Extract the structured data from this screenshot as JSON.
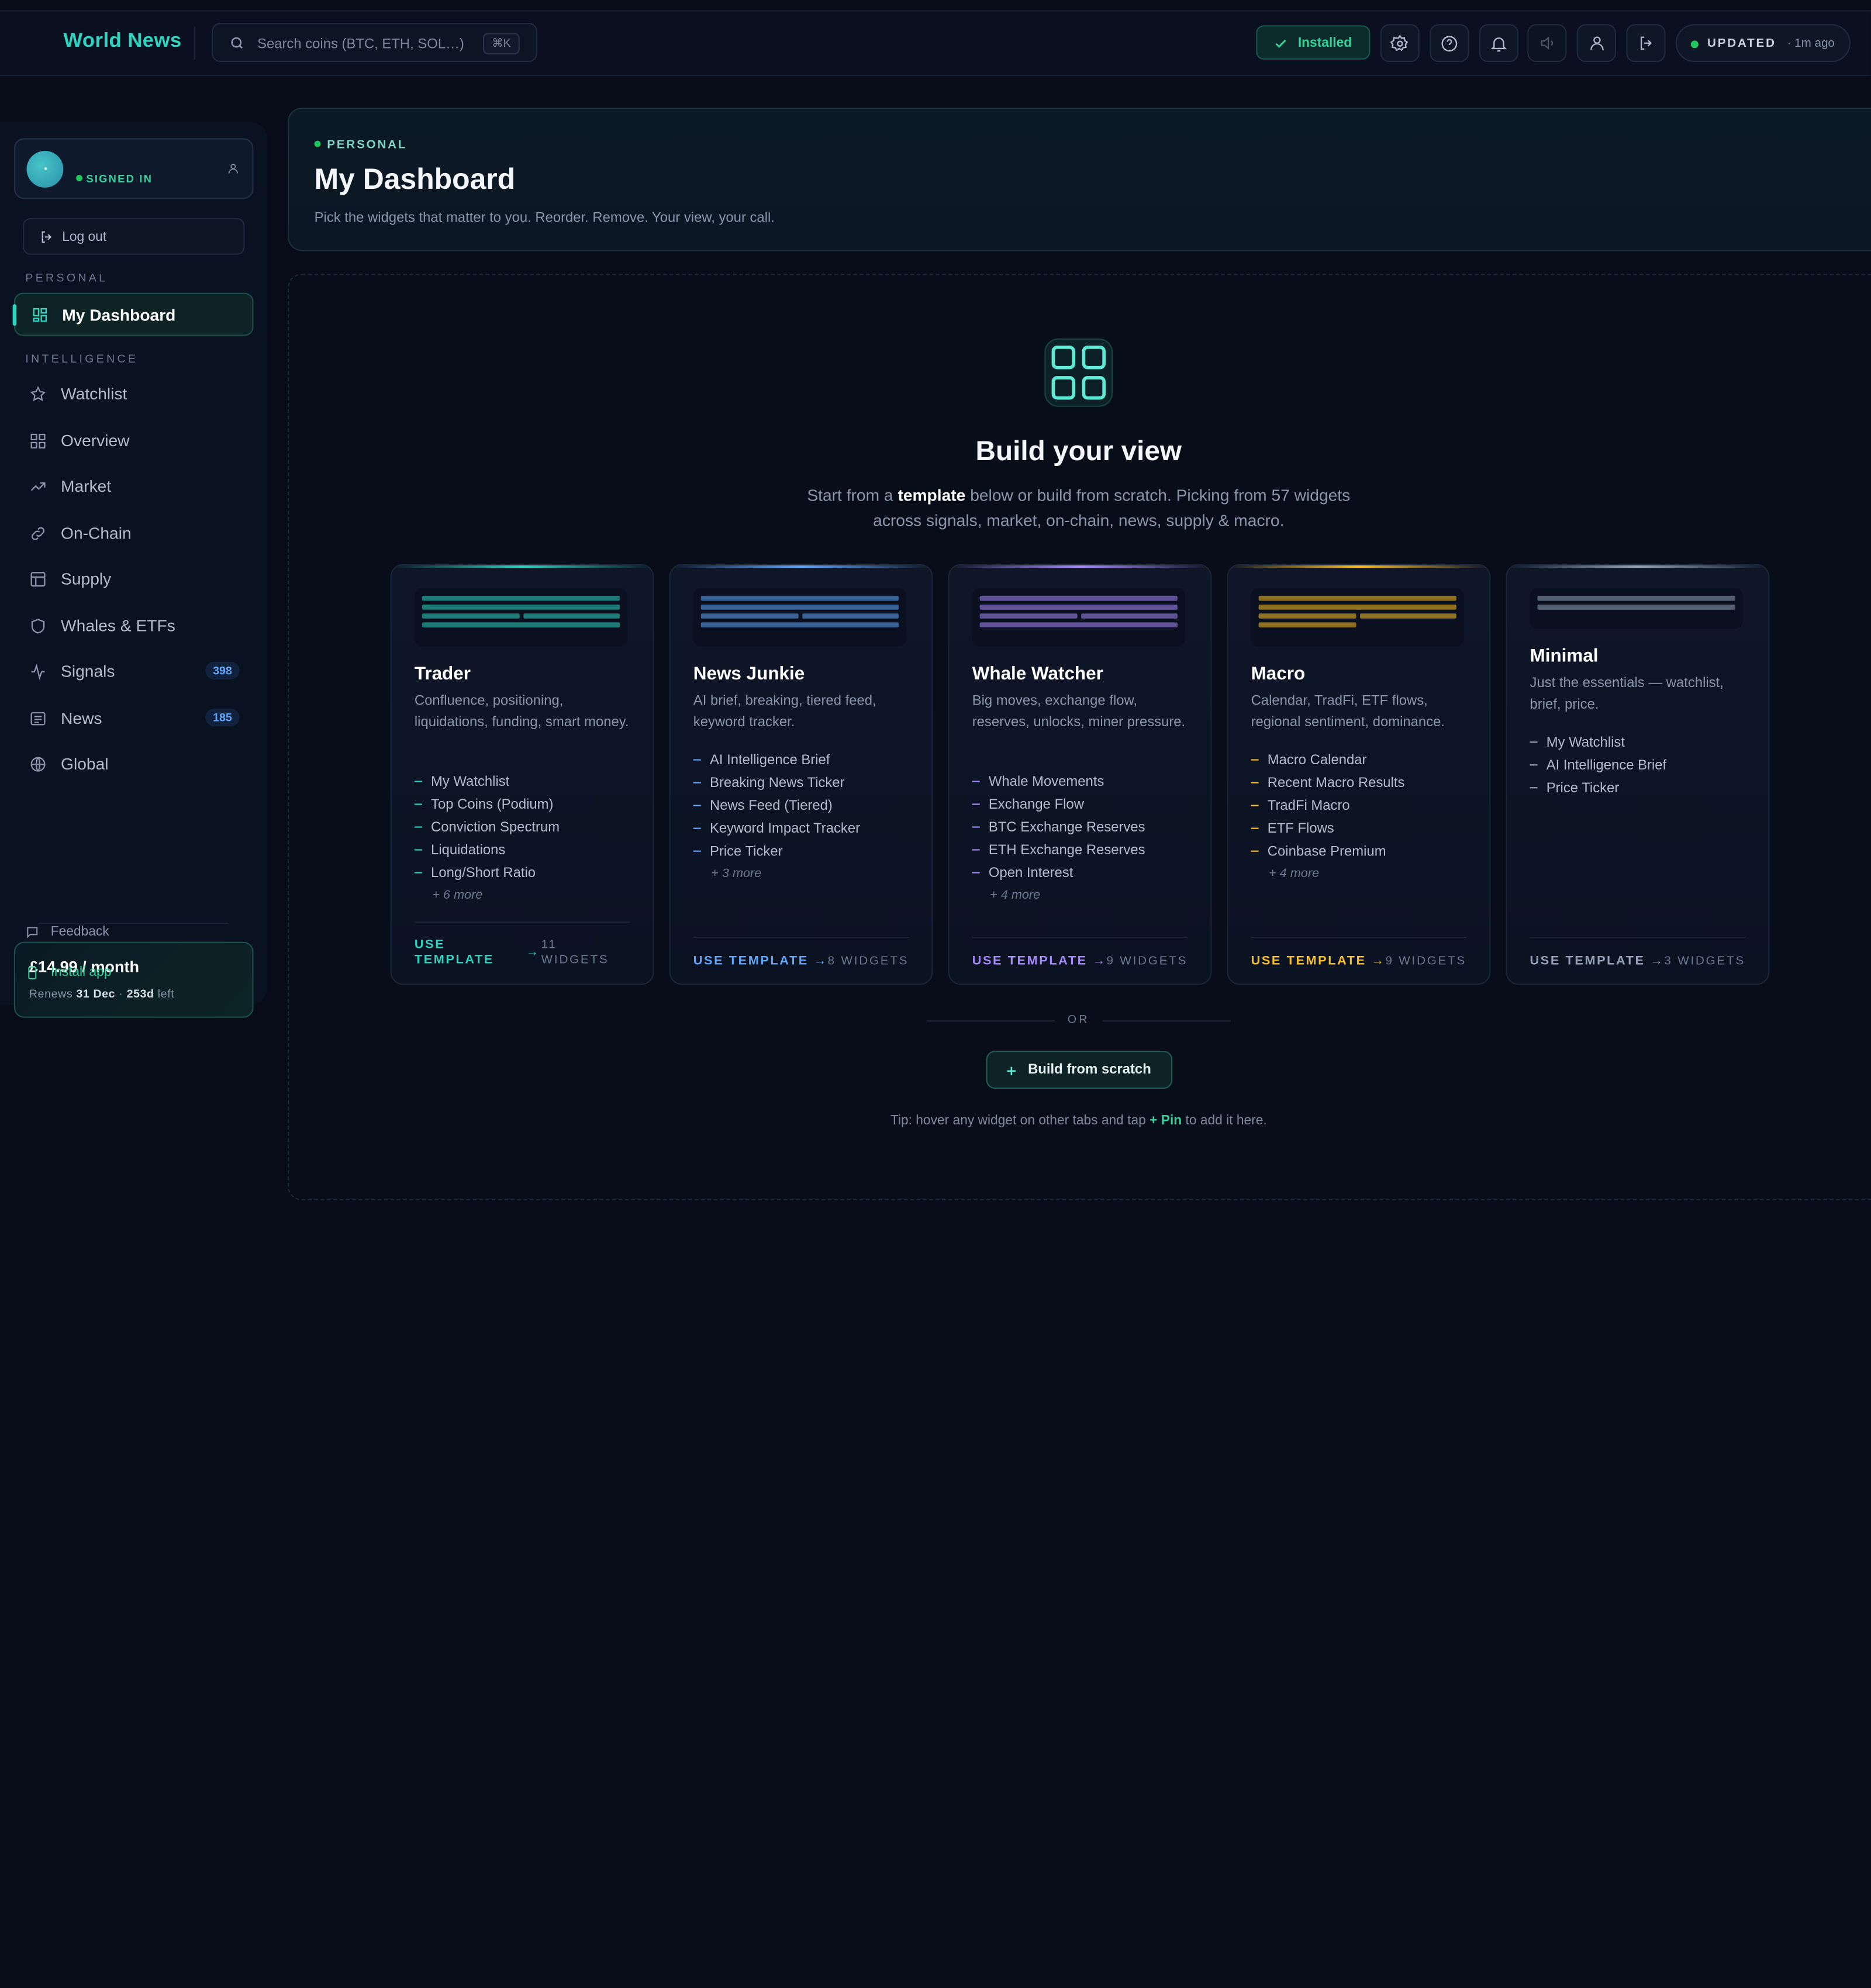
{
  "app": {
    "brand": "World News"
  },
  "search": {
    "placeholder": "Search coins (BTC, ETH, SOL…)",
    "shortcut": "⌘K"
  },
  "topbar": {
    "installed_label": "Installed",
    "icons": [
      "settings-icon",
      "help-icon",
      "bell-icon",
      "volume-icon",
      "user-icon",
      "logout-icon"
    ],
    "status_label": "UPDATED",
    "status_age": "· 1m ago"
  },
  "sidebar": {
    "user_status": "SIGNED IN",
    "logout_label": "Log out",
    "sections": {
      "personal": "PERSONAL",
      "intelligence": "INTELLIGENCE"
    },
    "items": [
      {
        "label": "My Dashboard",
        "icon": "dashboard-icon",
        "active": true
      },
      {
        "label": "Watchlist",
        "icon": "star-icon"
      },
      {
        "label": "Overview",
        "icon": "grid-icon"
      },
      {
        "label": "Market",
        "icon": "trending-up-icon"
      },
      {
        "label": "On-Chain",
        "icon": "link-icon"
      },
      {
        "label": "Supply",
        "icon": "table-icon"
      },
      {
        "label": "Whales & ETFs",
        "icon": "shield-icon"
      },
      {
        "label": "Signals",
        "icon": "activity-icon",
        "badge": "398"
      },
      {
        "label": "News",
        "icon": "newspaper-icon",
        "badge": "185"
      },
      {
        "label": "Global",
        "icon": "globe-icon"
      }
    ],
    "plan": {
      "price": "£14.99 / month",
      "renews_prefix": "Renews",
      "renews_date": "31 Dec",
      "sep": "·",
      "days_left": "253d",
      "left_suffix": "left"
    },
    "feedback_label": "Feedback",
    "install_label": "Install app"
  },
  "header": {
    "kicker": "PERSONAL",
    "title": "My Dashboard",
    "subtitle": "Pick the widgets that matter to you. Reorder. Remove. Your view, your call."
  },
  "builder": {
    "title": "Build your view",
    "lead_a": "Start from a",
    "lead_bold": "template",
    "lead_b": "below or build from scratch. Picking from 57 widgets across signals, market, on-chain, news, supply & macro.",
    "or_label": "OR",
    "scratch_label": "Build from scratch",
    "tip_a": "Tip: hover any widget on other tabs and tap",
    "tip_bold": "+ Pin",
    "tip_b": "to add it here."
  },
  "templates": [
    {
      "name": "Trader",
      "color": "#2dd4bf",
      "desc": "Confluence, positioning, liquidations, funding, smart money.",
      "widgets": [
        "My Watchlist",
        "Top Coins (Podium)",
        "Conviction Spectrum",
        "Liquidations",
        "Long/Short Ratio"
      ],
      "more": "+ 6 more",
      "use": "USE TEMPLATE",
      "count": "11 WIDGETS"
    },
    {
      "name": "News Junkie",
      "color": "#60a5fa",
      "desc": "AI brief, breaking, tiered feed, keyword tracker.",
      "widgets": [
        "AI Intelligence Brief",
        "Breaking News Ticker",
        "News Feed (Tiered)",
        "Keyword Impact Tracker",
        "Price Ticker"
      ],
      "more": "+ 3 more",
      "use": "USE TEMPLATE",
      "count": "8 WIDGETS"
    },
    {
      "name": "Whale Watcher",
      "color": "#a78bfa",
      "desc": "Big moves, exchange flow, reserves, unlocks, miner pressure.",
      "widgets": [
        "Whale Movements",
        "Exchange Flow",
        "BTC Exchange Reserves",
        "ETH Exchange Reserves",
        "Open Interest"
      ],
      "more": "+ 4 more",
      "use": "USE TEMPLATE",
      "count": "9 WIDGETS"
    },
    {
      "name": "Macro",
      "color": "#fbbf24",
      "desc": "Calendar, TradFi, ETF flows, regional sentiment, dominance.",
      "widgets": [
        "Macro Calendar",
        "Recent Macro Results",
        "TradFi Macro",
        "ETF Flows",
        "Coinbase Premium"
      ],
      "more": "+ 4 more",
      "use": "USE TEMPLATE",
      "count": "9 WIDGETS"
    },
    {
      "name": "Minimal",
      "color": "#94a3b8",
      "desc": "Just the essentials — watchlist, brief, price.",
      "widgets": [
        "My Watchlist",
        "AI Intelligence Brief",
        "Price Ticker"
      ],
      "more": "",
      "use": "USE TEMPLATE",
      "count": "3 WIDGETS"
    }
  ]
}
